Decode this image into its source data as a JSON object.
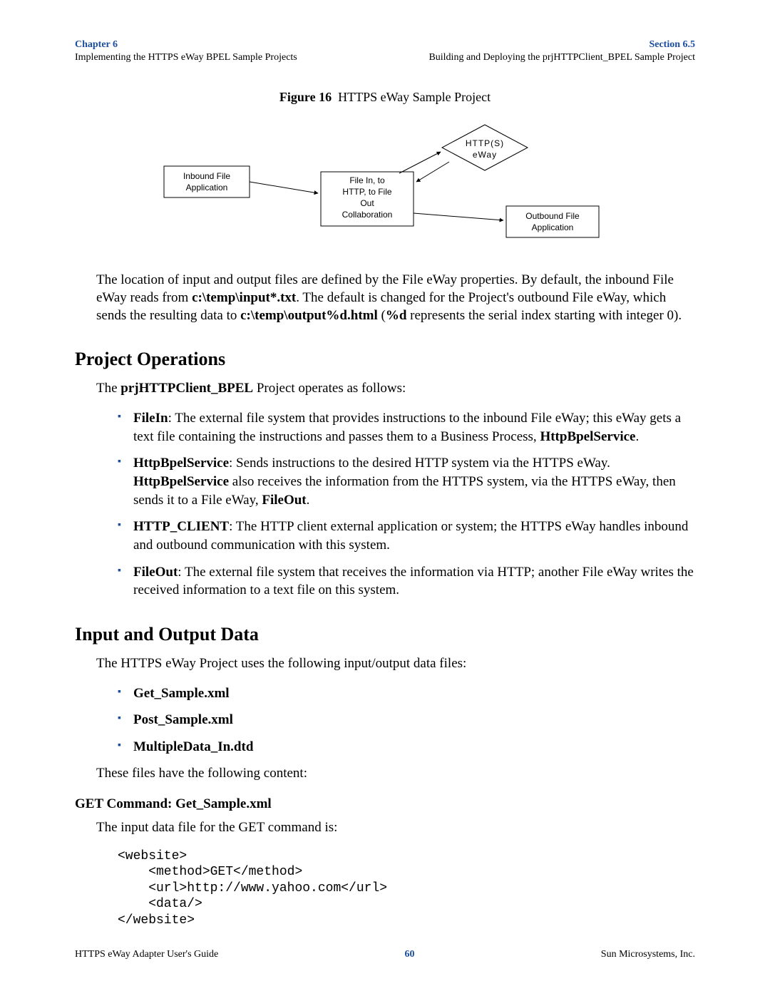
{
  "header": {
    "left_top": "Chapter 6",
    "left_sub": "Implementing the HTTPS eWay BPEL Sample Projects",
    "right_top": "Section 6.5",
    "right_sub": "Building and Deploying the prjHTTPClient_BPEL Sample Project"
  },
  "figure": {
    "label": "Figure 16",
    "title": "HTTPS eWay Sample Project",
    "diagram": {
      "inbound_l1": "Inbound File",
      "inbound_l2": "Application",
      "center_l1": "File In, to",
      "center_l2": "HTTP, to File",
      "center_l3": "Out",
      "center_l4": "Collaboration",
      "https_l1": "HTTP(S)",
      "https_l2": "eWay",
      "outbound_l1": "Outbound File",
      "outbound_l2": "Application"
    }
  },
  "para1": {
    "t1": "The location of input and output files are defined by the File eWay properties. By default, the inbound File eWay reads from ",
    "b1": "c:\\temp\\input*.txt",
    "t2": ". The default is changed for the Project's outbound File eWay, which sends the resulting data to ",
    "b2": "c:\\temp\\output%d.html",
    "t3": " (",
    "b3": "%d",
    "t4": " represents the serial index starting with integer 0)."
  },
  "ops": {
    "heading": "Project Operations",
    "intro_t1": "The ",
    "intro_b": "prjHTTPClient_BPEL",
    "intro_t2": " Project operates as follows:",
    "items": [
      {
        "b1": "FileIn",
        "t1": ": The external file system that provides instructions to the inbound File eWay; this eWay gets a text file containing the instructions and passes them to a Business Process, ",
        "b2": "HttpBpelService",
        "t2": "."
      },
      {
        "b1": "HttpBpelService",
        "t1": ": Sends instructions to the desired HTTP system via the HTTPS eWay. ",
        "b2": "HttpBpelService",
        "t2": " also receives the information from the HTTPS system, via the HTTPS eWay, then sends it to a File eWay, ",
        "b3": "FileOut",
        "t3": "."
      },
      {
        "b1": "HTTP_CLIENT",
        "t1": ": The HTTP client external application or system; the HTTPS eWay handles inbound and outbound communication with this system."
      },
      {
        "b1": "FileOut",
        "t1": ": The external file system that receives the information via HTTP; another File eWay writes the received information to a text file on this system."
      }
    ]
  },
  "io": {
    "heading": "Input and Output Data",
    "intro": "The HTTPS eWay Project uses the following input/output data files:",
    "files": [
      "Get_Sample.xml",
      "Post_Sample.xml",
      "MultipleData_In.dtd"
    ],
    "post_list": "These files have the following content:",
    "get_heading": "GET Command: Get_Sample.xml",
    "get_intro": "The input data file for the GET command is:",
    "get_code": "<website>\n    <method>GET</method>\n    <url>http://www.yahoo.com</url>\n    <data/>\n</website>"
  },
  "footer": {
    "left": "HTTPS eWay Adapter User's Guide",
    "page": "60",
    "right": "Sun Microsystems, Inc."
  }
}
